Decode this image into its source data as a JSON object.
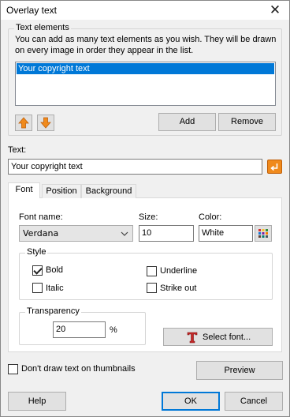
{
  "window": {
    "title": "Overlay text",
    "close_symbol": "✕"
  },
  "text_elements": {
    "legend": "Text elements",
    "description": "You can add as many text elements as you wish. They will be drawn on every image in order they appear in the list.",
    "items": [
      {
        "label": "Your copyright text",
        "selected": true
      }
    ],
    "add_label": "Add",
    "remove_label": "Remove",
    "move_up_icon": "arrow-up-icon",
    "move_down_icon": "arrow-down-icon"
  },
  "text": {
    "label": "Text:",
    "value": "Your copyright text",
    "insert_icon": "insert-variable-icon"
  },
  "tabs": [
    {
      "label": "Font",
      "active": true
    },
    {
      "label": "Position",
      "active": false
    },
    {
      "label": "Background",
      "active": false
    }
  ],
  "font": {
    "name_label": "Font name:",
    "name_value": "Verdana",
    "size_label": "Size:",
    "size_value": "10",
    "color_label": "Color:",
    "color_value": "White",
    "style": {
      "legend": "Style",
      "bold_label": "Bold",
      "bold_checked": true,
      "italic_label": "Italic",
      "italic_checked": false,
      "underline_label": "Underline",
      "underline_checked": false,
      "strikeout_label": "Strike out",
      "strikeout_checked": false
    },
    "transparency": {
      "legend": "Transparency",
      "value": "20",
      "unit": "%"
    },
    "select_font_label": "Select font..."
  },
  "thumbnails": {
    "label": "Don't draw text on thumbnails",
    "checked": false
  },
  "buttons": {
    "preview": "Preview",
    "help": "Help",
    "ok": "OK",
    "cancel": "Cancel"
  },
  "colors": {
    "accent": "#0078d7",
    "selection": "#0078d7",
    "arrow": "#f08a1c"
  }
}
